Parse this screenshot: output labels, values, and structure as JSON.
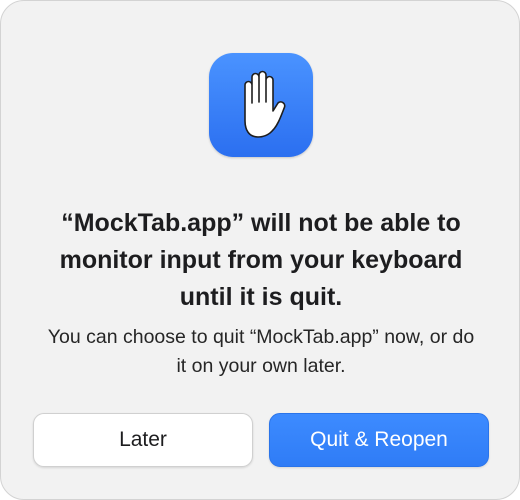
{
  "dialog": {
    "icon": "raised-hand-icon",
    "accent_color": "#2f7cf6",
    "title": "“MockTab.app” will not be able to monitor input from your keyboard until it is quit.",
    "message": "You can choose to quit “MockTab.app” now, or do it on your own later.",
    "buttons": {
      "later_label": "Later",
      "quit_label": "Quit & Reopen"
    }
  }
}
